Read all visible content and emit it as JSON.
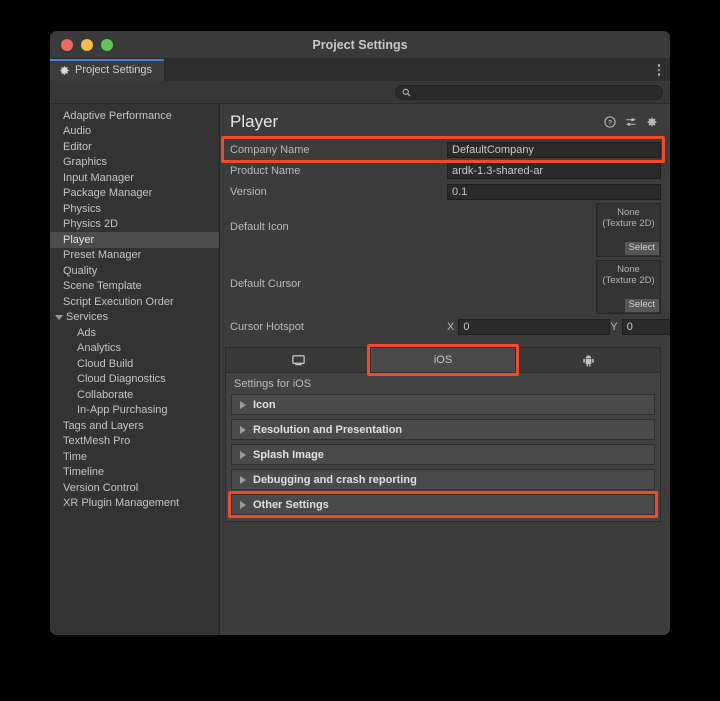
{
  "window": {
    "title": "Project Settings",
    "traffic_lights": [
      "close-red",
      "minimize-yellow",
      "maximize-green"
    ]
  },
  "tabstrip": {
    "tab_label": "Project Settings",
    "tab_icon": "gear-icon",
    "menu_icon": "kebab-menu-icon"
  },
  "search": {
    "value": "",
    "placeholder": "",
    "icon": "search-icon"
  },
  "sidebar": {
    "items": [
      {
        "label": "Adaptive Performance",
        "level": 0,
        "selected": false
      },
      {
        "label": "Audio",
        "level": 0,
        "selected": false
      },
      {
        "label": "Editor",
        "level": 0,
        "selected": false
      },
      {
        "label": "Graphics",
        "level": 0,
        "selected": false
      },
      {
        "label": "Input Manager",
        "level": 0,
        "selected": false
      },
      {
        "label": "Package Manager",
        "level": 0,
        "selected": false
      },
      {
        "label": "Physics",
        "level": 0,
        "selected": false
      },
      {
        "label": "Physics 2D",
        "level": 0,
        "selected": false
      },
      {
        "label": "Player",
        "level": 0,
        "selected": true
      },
      {
        "label": "Preset Manager",
        "level": 0,
        "selected": false
      },
      {
        "label": "Quality",
        "level": 0,
        "selected": false
      },
      {
        "label": "Scene Template",
        "level": 0,
        "selected": false
      },
      {
        "label": "Script Execution Order",
        "level": 0,
        "selected": false
      },
      {
        "label": "Services",
        "level": 0,
        "selected": false,
        "expanded": true
      },
      {
        "label": "Ads",
        "level": 1,
        "selected": false
      },
      {
        "label": "Analytics",
        "level": 1,
        "selected": false
      },
      {
        "label": "Cloud Build",
        "level": 1,
        "selected": false
      },
      {
        "label": "Cloud Diagnostics",
        "level": 1,
        "selected": false
      },
      {
        "label": "Collaborate",
        "level": 1,
        "selected": false
      },
      {
        "label": "In-App Purchasing",
        "level": 1,
        "selected": false
      },
      {
        "label": "Tags and Layers",
        "level": 0,
        "selected": false
      },
      {
        "label": "TextMesh Pro",
        "level": 0,
        "selected": false
      },
      {
        "label": "Time",
        "level": 0,
        "selected": false
      },
      {
        "label": "Timeline",
        "level": 0,
        "selected": false
      },
      {
        "label": "Version Control",
        "level": 0,
        "selected": false
      },
      {
        "label": "XR Plugin Management",
        "level": 0,
        "selected": false
      }
    ]
  },
  "main": {
    "title": "Player",
    "header_icons": [
      "help-icon",
      "preset-icon",
      "gear-icon"
    ],
    "fields": {
      "company_name_label": "Company Name",
      "company_name_value": "DefaultCompany",
      "product_name_label": "Product Name",
      "product_name_value": "ardk-1.3-shared-ar",
      "version_label": "Version",
      "version_value": "0.1"
    },
    "default_icon": {
      "label": "Default Icon",
      "none_line1": "None",
      "none_line2": "(Texture 2D)",
      "select_label": "Select"
    },
    "default_cursor": {
      "label": "Default Cursor",
      "none_line1": "None",
      "none_line2": "(Texture 2D)",
      "select_label": "Select"
    },
    "cursor_hotspot": {
      "label": "Cursor Hotspot",
      "x_letter": "X",
      "x_value": "0",
      "y_letter": "Y",
      "y_value": "0"
    },
    "platform_tabs": [
      {
        "label": "",
        "icon": "standalone-monitor-icon",
        "active": false
      },
      {
        "label": "iOS",
        "icon": "",
        "active": true,
        "annotated": true
      },
      {
        "label": "",
        "icon": "android-robot-icon",
        "active": false
      }
    ],
    "settings_for": "Settings for iOS",
    "foldouts": [
      {
        "label": "Icon",
        "expanded": false,
        "annotated": false
      },
      {
        "label": "Resolution and Presentation",
        "expanded": false,
        "annotated": false
      },
      {
        "label": "Splash Image",
        "expanded": false,
        "annotated": false
      },
      {
        "label": "Debugging and crash reporting",
        "expanded": false,
        "annotated": false
      },
      {
        "label": "Other Settings",
        "expanded": false,
        "annotated": true
      }
    ]
  },
  "annotation": {
    "color": "#f04a28",
    "targets": [
      "company-name-input",
      "platform-tab-ios",
      "foldout-other-settings"
    ]
  }
}
